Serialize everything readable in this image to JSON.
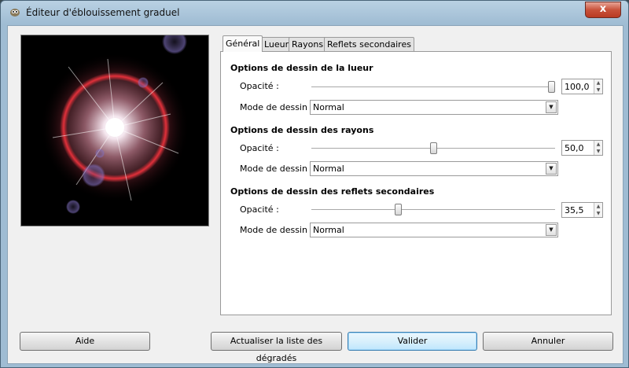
{
  "window": {
    "title": "Éditeur d'éblouissement graduel",
    "close_label": "x"
  },
  "tabs": [
    {
      "label": "Général",
      "active": true
    },
    {
      "label": "Lueur",
      "active": false
    },
    {
      "label": "Rayons",
      "active": false
    },
    {
      "label": "Reflets secondaires",
      "active": false
    }
  ],
  "sections": [
    {
      "title": "Options de dessin de la lueur",
      "opacity_label": "Opacité :",
      "opacity_value": "100,0",
      "opacity_percent": 100,
      "mode_label": "Mode de dessin :",
      "mode_value": "Normal"
    },
    {
      "title": "Options de dessin des rayons",
      "opacity_label": "Opacité :",
      "opacity_value": "50,0",
      "opacity_percent": 50,
      "mode_label": "Mode de dessin :",
      "mode_value": "Normal"
    },
    {
      "title": "Options de dessin des reflets secondaires",
      "opacity_label": "Opacité :",
      "opacity_value": "35,5",
      "opacity_percent": 35.5,
      "mode_label": "Mode de dessin :",
      "mode_value": "Normal"
    }
  ],
  "buttons": {
    "help": "Aide",
    "refresh": "Actualiser la liste des dégradés",
    "ok": "Valider",
    "cancel": "Annuler"
  },
  "colors": {
    "flare_ring": "#e0303a",
    "default_button": "#3c7fb1"
  }
}
